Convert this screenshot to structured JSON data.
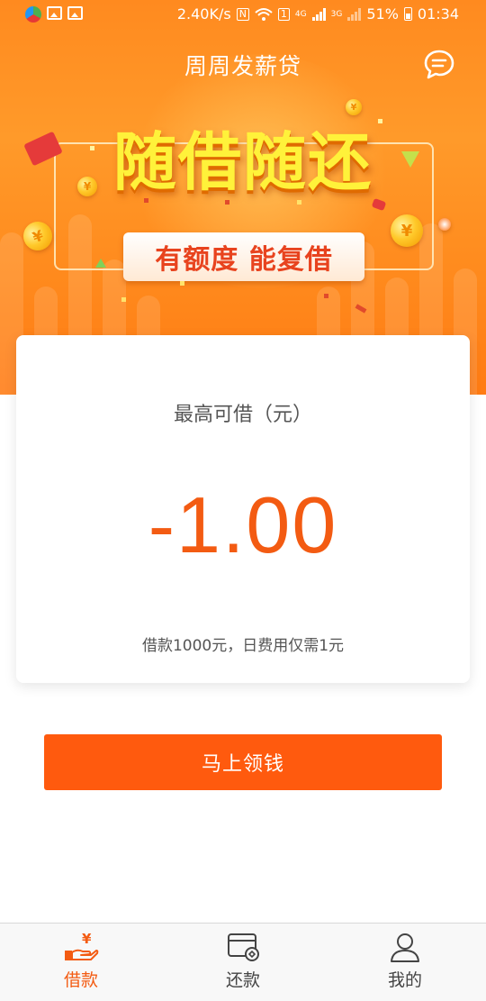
{
  "status_bar": {
    "speed": "2.40K/s",
    "network_4g": "4G",
    "network_3g": "3G",
    "sim_badge": "1",
    "nfc": "N",
    "battery": "51%",
    "time": "01:34"
  },
  "header": {
    "title": "周周发薪贷",
    "message_icon": "chat-bubble-icon"
  },
  "banner": {
    "headline": "随借随还",
    "subline": "有额度 能复借",
    "coin_symbol": "¥"
  },
  "card": {
    "label": "最高可借（元）",
    "amount": "-1.00",
    "note": "借款1000元，日费用仅需1元"
  },
  "cta": {
    "label": "马上领钱"
  },
  "tabs": [
    {
      "label": "借款",
      "icon": "hand-yen-icon",
      "active": true
    },
    {
      "label": "还款",
      "icon": "card-repay-icon",
      "active": false
    },
    {
      "label": "我的",
      "icon": "user-icon",
      "active": false
    }
  ],
  "colors": {
    "brand_orange": "#ff5a0e",
    "amount_orange": "#f35b12",
    "header_orange": "#ff8a1f",
    "headline_yellow": "#fff23a",
    "subline_red": "#e8431e"
  }
}
